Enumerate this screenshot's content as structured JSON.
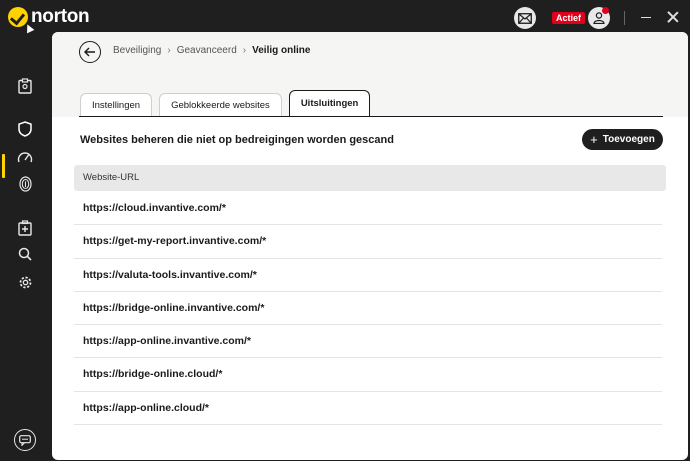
{
  "app": {
    "logo_text": "norton"
  },
  "topbar": {
    "status_badge": "Actief"
  },
  "breadcrumb": [
    "Beveiliging",
    "Geavanceerd",
    "Veilig online"
  ],
  "tabs": [
    {
      "label": "Instellingen",
      "active": false
    },
    {
      "label": "Geblokkeerde websites",
      "active": false
    },
    {
      "label": "Uitsluitingen",
      "active": true
    }
  ],
  "section": {
    "title": "Websites beheren die niet op bedreigingen worden gescand",
    "add_button": "Toevoegen"
  },
  "table": {
    "column_header": "Website-URL",
    "rows": [
      "https://cloud.invantive.com/*",
      "https://get-my-report.invantive.com/*",
      "https://valuta-tools.invantive.com/*",
      "https://bridge-online.invantive.com/*",
      "https://app-online.invantive.com/*",
      "https://bridge-online.cloud/*",
      "https://app-online.cloud/*"
    ]
  },
  "icons": {
    "topbar": [
      "mail-icon",
      "user-icon",
      "minimize-icon",
      "close-icon"
    ],
    "sidebar": [
      "clipboard-icon",
      "shield-icon",
      "speedometer-icon",
      "fingerprint-icon",
      "medical-kit-icon",
      "search-icon",
      "gear-icon",
      "chat-icon"
    ]
  },
  "colors": {
    "accent": "#ffd200",
    "badge": "#e0001b",
    "dark": "#1f1f1f"
  }
}
